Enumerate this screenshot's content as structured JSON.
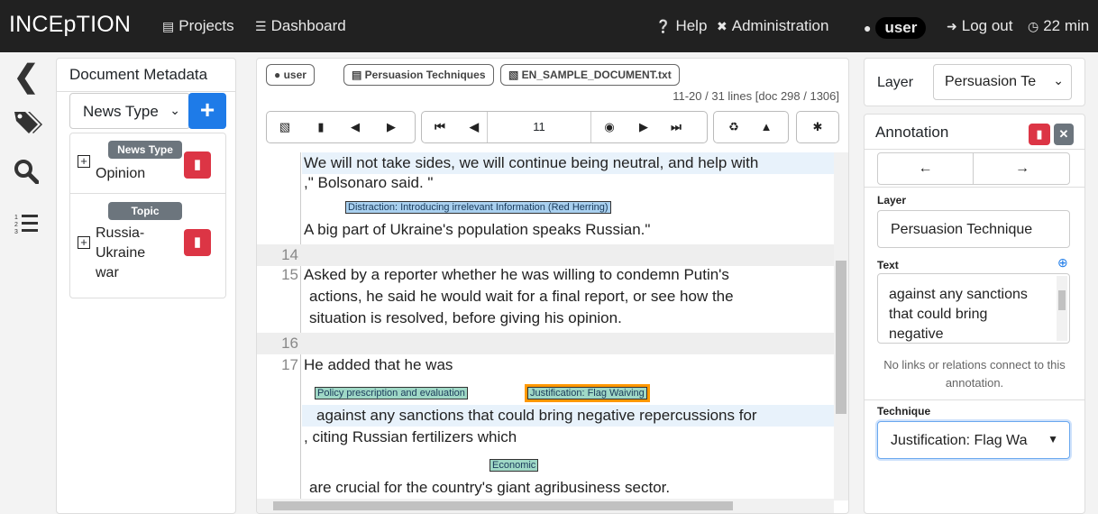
{
  "navbar": {
    "brand": "INCEpTION",
    "projects": "Projects",
    "dashboard": "Dashboard",
    "help": "Help",
    "administration": "Administration",
    "user": "user",
    "logout": "Log out",
    "timer": "22 min"
  },
  "metadata": {
    "title": "Document Metadata",
    "layer_select": "News Type",
    "items": [
      {
        "badge": "News Type",
        "value": "Opinion"
      },
      {
        "badge": "Topic",
        "value_lines": [
          "Russia-",
          "Ukraine",
          "war"
        ]
      }
    ]
  },
  "editor": {
    "breadcrumb": {
      "user": "user",
      "project": "Persuasion Techniques",
      "document": "EN_SAMPLE_DOCUMENT.txt"
    },
    "line_status": "11-20 / 31 lines [doc 298 / 1306]",
    "page_input": "11",
    "lines": {
      "l13a": "We will not take sides, we will continue being neutral, and help with",
      "l13b": ",\" Bolsonaro said. \"",
      "l13c": "A big part of Ukraine's population speaks Russian.\"",
      "l15a": "Asked by a reporter whether he was willing to condemn Putin's",
      "l15b": "actions, he said he would wait for a final report, or see how the",
      "l15c": "situation is resolved, before giving his opinion.",
      "l17a": "He added that he was",
      "l17b": "against any sanctions that could bring negative repercussions for",
      "l17c": ", citing Russian fertilizers which",
      "l17d": "are crucial for the country's giant agribusiness sector."
    },
    "line_numbers": {
      "n14": "14",
      "n15": "15",
      "n16": "16",
      "n17": "17"
    },
    "annotations": {
      "red_herring": "Distraction: Introducing irrelevant Information (Red Herring)",
      "policy": "Policy prescription and evaluation",
      "flag_waving": "Justification: Flag Waiving",
      "economic": "Economic"
    }
  },
  "right": {
    "layer_label": "Layer",
    "layer_select": "Persuasion Te",
    "annotation_title": "Annotation",
    "field_layer_label": "Layer",
    "field_layer_value": "Persuasion Technique",
    "field_text_label": "Text",
    "field_text_lines": [
      "against any sanctions",
      "that could bring",
      "negative"
    ],
    "no_links": "No links or relations connect to this annotation.",
    "technique_label": "Technique",
    "technique_value": "Justification: Flag Wa"
  },
  "colors": {
    "accent": "#1e7be8",
    "danger": "#dc3545",
    "selected": "#ff9800"
  }
}
